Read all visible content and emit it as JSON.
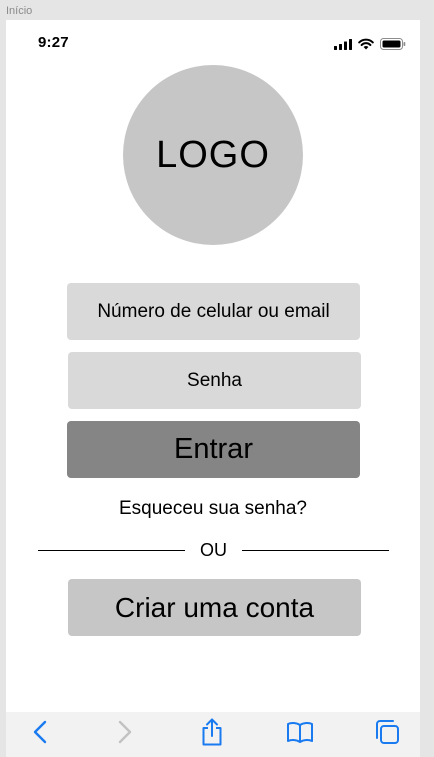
{
  "frame": {
    "label": "Início"
  },
  "status_bar": {
    "time": "9:27",
    "icons": [
      "signal-icon",
      "wifi-icon",
      "battery-icon"
    ]
  },
  "logo": {
    "text": "LOGO"
  },
  "form": {
    "phone_field_text": "Número de celular ou email",
    "password_field_text": "Senha",
    "enter_button_label": "Entrar",
    "forgot_password_link": "Esqueceu sua senha?",
    "divider_text": "OU",
    "create_account_label": "Criar uma conta"
  },
  "toolbar": {
    "icons": [
      "back-icon",
      "forward-icon",
      "share-icon",
      "bookmarks-icon",
      "tabs-icon"
    ],
    "accent_color": "#1a7bf0",
    "disabled_color": "#c2c2c2"
  },
  "colors": {
    "logo_fill": "#c6c6c6",
    "field_fill": "#d9d9d9",
    "enter_button_fill": "#858585",
    "create_button_fill": "#c6c6c6"
  }
}
